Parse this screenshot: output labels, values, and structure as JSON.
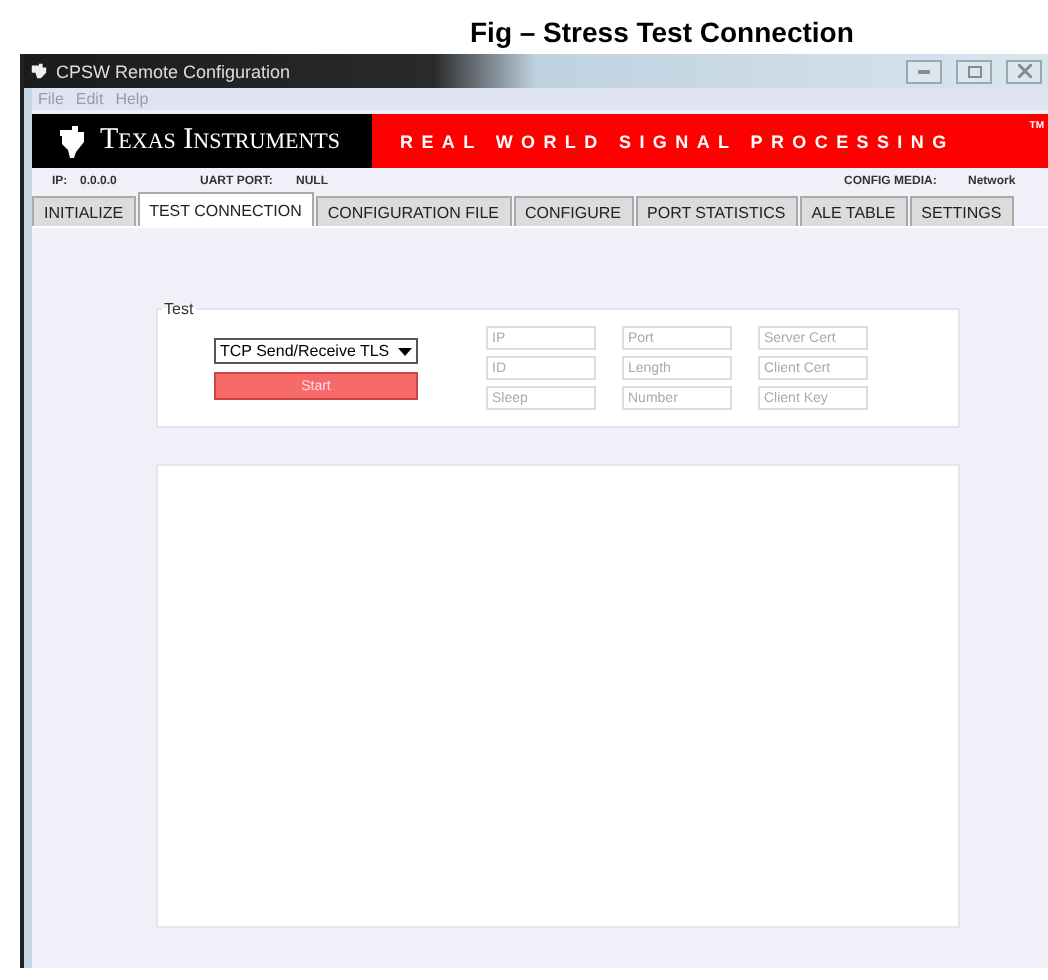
{
  "caption": "Fig – Stress Test Connection",
  "window": {
    "title": "CPSW Remote Configuration"
  },
  "menu": [
    "File",
    "Edit",
    "Help"
  ],
  "banner": {
    "brand": "Texas Instruments",
    "tagline": "REAL WORLD SIGNAL PROCESSING",
    "mark": "TM"
  },
  "info": {
    "ip_label": "IP:",
    "ip": "0.0.0.0",
    "uart_label": "UART PORT:",
    "uart": "NULL",
    "media_label": "CONFIG MEDIA:",
    "media": "Network"
  },
  "tabs": [
    {
      "label": "INITIALIZE",
      "selected": false
    },
    {
      "label": "TEST CONNECTION",
      "selected": true
    },
    {
      "label": "CONFIGURATION FILE",
      "selected": false
    },
    {
      "label": "CONFIGURE",
      "selected": false
    },
    {
      "label": "PORT STATISTICS",
      "selected": false
    },
    {
      "label": "ALE TABLE",
      "selected": false
    },
    {
      "label": "SETTINGS",
      "selected": false
    }
  ],
  "test": {
    "legend": "Test",
    "mode": "TCP Send/Receive TLS",
    "button": "Start",
    "fields": [
      {
        "placeholder": "IP"
      },
      {
        "placeholder": "Port"
      },
      {
        "placeholder": "Server Cert"
      },
      {
        "placeholder": "ID"
      },
      {
        "placeholder": "Length"
      },
      {
        "placeholder": "Client Cert"
      },
      {
        "placeholder": "Sleep"
      },
      {
        "placeholder": "Number"
      },
      {
        "placeholder": "Client Key"
      }
    ]
  }
}
